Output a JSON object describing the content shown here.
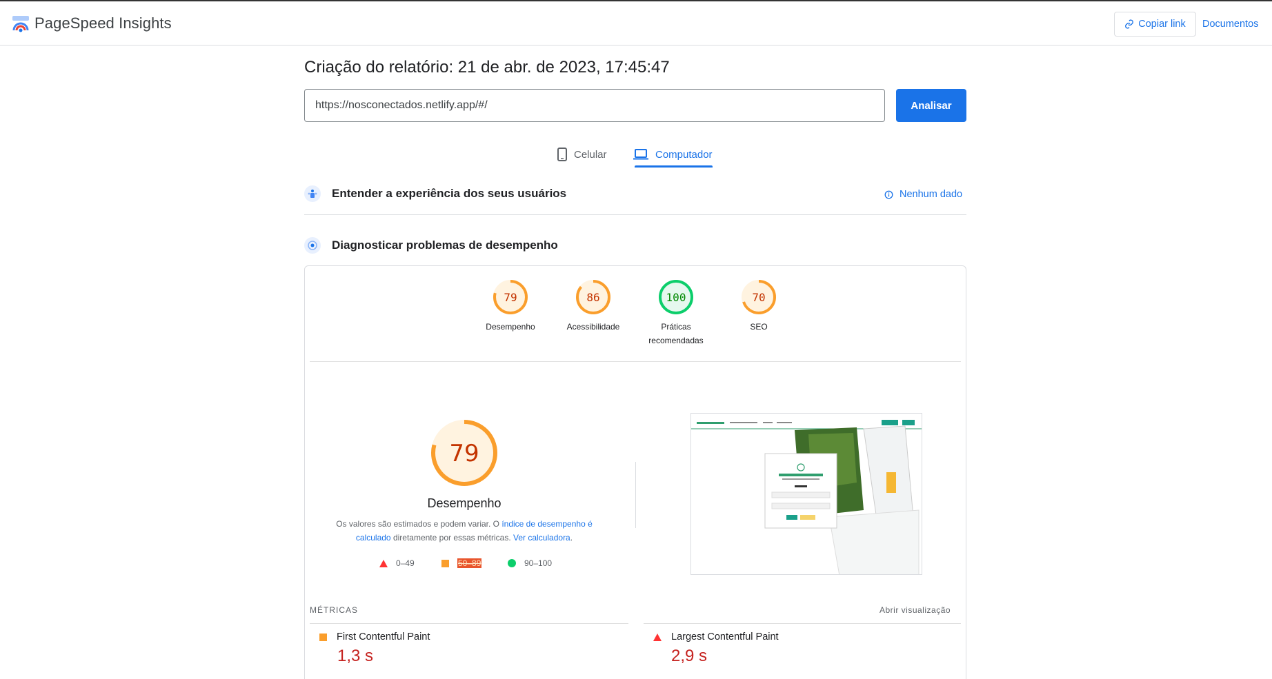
{
  "app": {
    "title": "PageSpeed Insights",
    "copy_link": "Copiar link",
    "docs": "Documentos"
  },
  "report": {
    "title": "Criação do relatório: 21 de abr. de 2023, 17:45:47",
    "url_value": "https://nosconectados.netlify.app/#/",
    "analyze_label": "Analisar"
  },
  "tabs": [
    {
      "label": "Celular",
      "active": false,
      "icon": "phone-icon"
    },
    {
      "label": "Computador",
      "active": true,
      "icon": "laptop-icon"
    }
  ],
  "sections": {
    "experience": {
      "title": "Entender a experiência dos seus usuários",
      "no_data": "Nenhum dado"
    },
    "diagnose": {
      "title": "Diagnosticar problemas de desempenho"
    }
  },
  "scores": [
    {
      "value": 79,
      "label": "Desempenho",
      "color": "#fa9e2c",
      "text_color": "#c33300"
    },
    {
      "value": 86,
      "label": "Acessibilidade",
      "color": "#fa9e2c",
      "text_color": "#c33300"
    },
    {
      "value": 100,
      "label": "Práticas recomendadas",
      "color": "#0cce6b",
      "text_color": "#008800"
    },
    {
      "value": 70,
      "label": "SEO",
      "color": "#fa9e2c",
      "text_color": "#c33300"
    }
  ],
  "performance": {
    "score": 79,
    "title": "Desempenho",
    "desc_prefix": "Os valores são estimados e podem variar. O ",
    "desc_link": "índice de desempenho é calculado",
    "desc_middle": " diretamente por essas métricas. ",
    "desc_link2": "Ver calculadora",
    "desc_end": ".",
    "legend": {
      "fail": "0–49",
      "average": "50–89",
      "pass": "90–100"
    }
  },
  "metrics": {
    "label": "MÉTRICAS",
    "expand": "Abrir visualização",
    "items": [
      {
        "name": "First Contentful Paint",
        "value": "1,3 s",
        "status": "average"
      },
      {
        "name": "Largest Contentful Paint",
        "value": "2,9 s",
        "status": "fail"
      }
    ]
  },
  "colors": {
    "accent": "#1a73e8",
    "average": "#fa9e2c",
    "pass": "#0cce6b",
    "fail": "#ff3333"
  }
}
